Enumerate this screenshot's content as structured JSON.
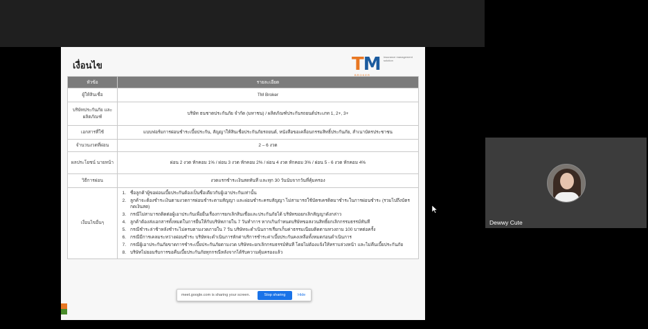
{
  "slide": {
    "title": "เงื่อนไข",
    "logo": {
      "tm": "TM",
      "broker": "BROKER",
      "tagline": "insurance management solution"
    },
    "table": {
      "header": [
        "หัวข้อ",
        "รายละเอียด"
      ],
      "rows": [
        {
          "label": "ผู้ให้สินเชื่อ",
          "value": "TM Broker"
        },
        {
          "label": "บริษัทประกันภัย และผลิตภัณฑ์",
          "value": "บริษัท ธนชาตประกันภัย จำกัด (มหาชน) / ผลิตภัณฑ์ประกันรถยนต์ประเภท 1, 2+, 3+"
        },
        {
          "label": "เอกสารที่ใช้",
          "value": "แบบฟอร์มการผ่อนชำระเบี้ยประกัน, สัญญาให้สินเชื่อประกันภัยรถยนต์, หนังสือขอเคลื่อนกรรมสิทธิ์ประกันภัย, สำเนาบัตรประชาชน"
        },
        {
          "label": "จำนวนงวดที่ผ่อน",
          "value": "2 – 6 งวด"
        },
        {
          "label": "ผลประโยชน์ นายหน้า",
          "value": "ผ่อน 2 งวด หักคอม 1% / ผ่อน 3 งวด หักคอม 2% / ผ่อน 4 งวด หักคอม 3% / ผ่อน 5 - 6 งวด หักคอม 4%"
        },
        {
          "label": "วิธีการผ่อน",
          "value": "งวดแรกชำระเงินสดทันที และทุก 30 วันนับจากวันที่คุ้มครอง"
        }
      ],
      "conditions_label": "เงื่อนไขอื่นๆ",
      "conditions": [
        {
          "n": "1.",
          "text": "ชื่อลูกค้าผู้ขอผ่อนเบี้ยประกันต้องเป็นชื่อเดียวกับผู้เอาประกันเท่านั้น"
        },
        {
          "n": "2.",
          "text": "ลูกค้าจะต้องชำระเงินตามงวดการผ่อนชำระตามสัญญา และผ่อนชำระครบสัญญา ไม่สามารถใช้บัตรเครดิตมาชำระในการผ่อนชำระ (รวมไปถึงบัตรกดเงินสด)"
        },
        {
          "n": "3.",
          "text": "กรณีไม่สามารถติดต่อผู้เอาประกันเพื่อยื่นเรื่องการยกเลิกสินเชื่อและประกันภัยได้ บริษัทขอยกเลิกสัญญาดังกล่าว"
        },
        {
          "n": "4.",
          "text": "ลูกค้าต้องส่งเอกสารทั้งหมดในการยื่นให้กับบริษัทภายใน 7 วันทำการ หากเกินกำหนดบริษัทขอสงวนสิทธิ์ยกเลิกกรรมธรรม์ทันที"
        },
        {
          "n": "5.",
          "text": "กรณีชำระล่าช้าหลังชำระไม่ครบตามงวดภายใน 7 วัน บริษัทจะดำเนินการเรียกเก็บค่าธรรมเนียมติดตามทวงถาม 100 บาทต่อครั้ง"
        },
        {
          "n": "6.",
          "text": "กรณีมีการเคลมระหว่างผ่อนชำระ บริษัทจะดำเนินการหักค่าบริการชำระค่าเบี้ยประกันคงเหลือทั้งหมดก่อนดำเนินการ"
        },
        {
          "n": "7.",
          "text": "กรณีผู้เอาประกันภัยขาดการชำระเบี้ยประกันภัยตามงวด บริษัทจะยกเลิกกรมธรรม์ทันที โดยไม่ต้องแจ้งให้ทราบล่วงหน้า และไม่คืนเบี้ยประกันภัย"
        },
        {
          "n": "8.",
          "text": "บริษัทไม่ยอมรับการขอคืนเบี้ยประกันภัยทุกกรณีหลังจากได้รับความคุ้มครองแล้ว"
        }
      ]
    }
  },
  "share_bar": {
    "message": "meet.google.com is sharing your screen.",
    "stop_label": "Stop sharing",
    "hide_label": "Hide"
  },
  "participant": {
    "name": "Dewwy Cute"
  },
  "colors": {
    "accent": "#e87722",
    "brand_blue": "#1b5b9e",
    "header_gray": "#7b7b7b",
    "stop_blue": "#1a73e8"
  }
}
